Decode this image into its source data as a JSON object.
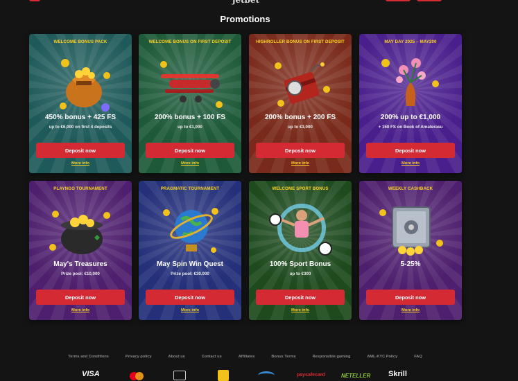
{
  "header": {
    "logo": "jetbet"
  },
  "page_title": "Promotions",
  "cards": [
    {
      "tag": "WELCOME BONUS PACK",
      "title": "450% bonus + 425 FS",
      "subtitle": "up to €6,000 on first 4 deposits",
      "button": "Deposit now",
      "more": "More info",
      "theme": "#1f5a5a",
      "art": "money-bag-icon"
    },
    {
      "tag": "WELCOME BONUS ON FIRST DEPOSIT",
      "title": "200% bonus + 100 FS",
      "subtitle": "up to €1,000",
      "button": "Deposit now",
      "more": "More info",
      "theme": "#1e5a3a",
      "art": "airplane-icon"
    },
    {
      "tag": "HIGHROLLER BONUS ON FIRST DEPOSIT",
      "title": "200% bonus + 200 FS",
      "subtitle": "up to €3,000",
      "button": "Deposit now",
      "more": "More info",
      "theme": "#7a2a1a",
      "art": "dynamite-icon"
    },
    {
      "tag": "MAY DAY 2025 – MAY200",
      "title": "200% up to €1,000",
      "subtitle": "+ 150 FS on Book of Amaterasu",
      "button": "Deposit now",
      "more": "More info",
      "theme": "#4a1e8c",
      "art": "flower-vase-icon"
    },
    {
      "tag": "PLAYNGO TOURNAMENT",
      "title": "May's Treasures",
      "subtitle": "Prize pool: €10,000",
      "button": "Deposit now",
      "more": "More info",
      "theme": "#4e1f6e",
      "art": "pot-of-gold-icon"
    },
    {
      "tag": "PRAGMATIC TOURNAMENT",
      "title": "May Spin Win Quest",
      "subtitle": "Prize pool: €30.000",
      "button": "Deposit now",
      "more": "More info",
      "theme": "#24307a",
      "art": "globe-icon"
    },
    {
      "tag": "WELCOME SPORT BONUS",
      "title": "100% Sport Bonus",
      "subtitle": "up to €300",
      "button": "Deposit now",
      "more": "More info",
      "theme": "#1e4a1e",
      "art": "football-player-icon"
    },
    {
      "tag": "WEEKLY CASHBACK",
      "title": "5-25%",
      "subtitle": "",
      "button": "Deposit now",
      "more": "More info",
      "theme": "#4e1f6e",
      "art": "safe-icon"
    }
  ],
  "footer": {
    "links": [
      "Terms and Conditions",
      "Privacy policy",
      "About us",
      "Contact us",
      "Affiliates",
      "Bonus Terms",
      "Responsible gaming",
      "AML-KYC Policy",
      "FAQ"
    ],
    "payments": [
      "VISA",
      "mastercard",
      "paysafecard",
      "NETELLER",
      "Skrill"
    ]
  },
  "colors": {
    "accent": "#d42a34",
    "highlight": "#ffd21f",
    "background": "#141414"
  }
}
